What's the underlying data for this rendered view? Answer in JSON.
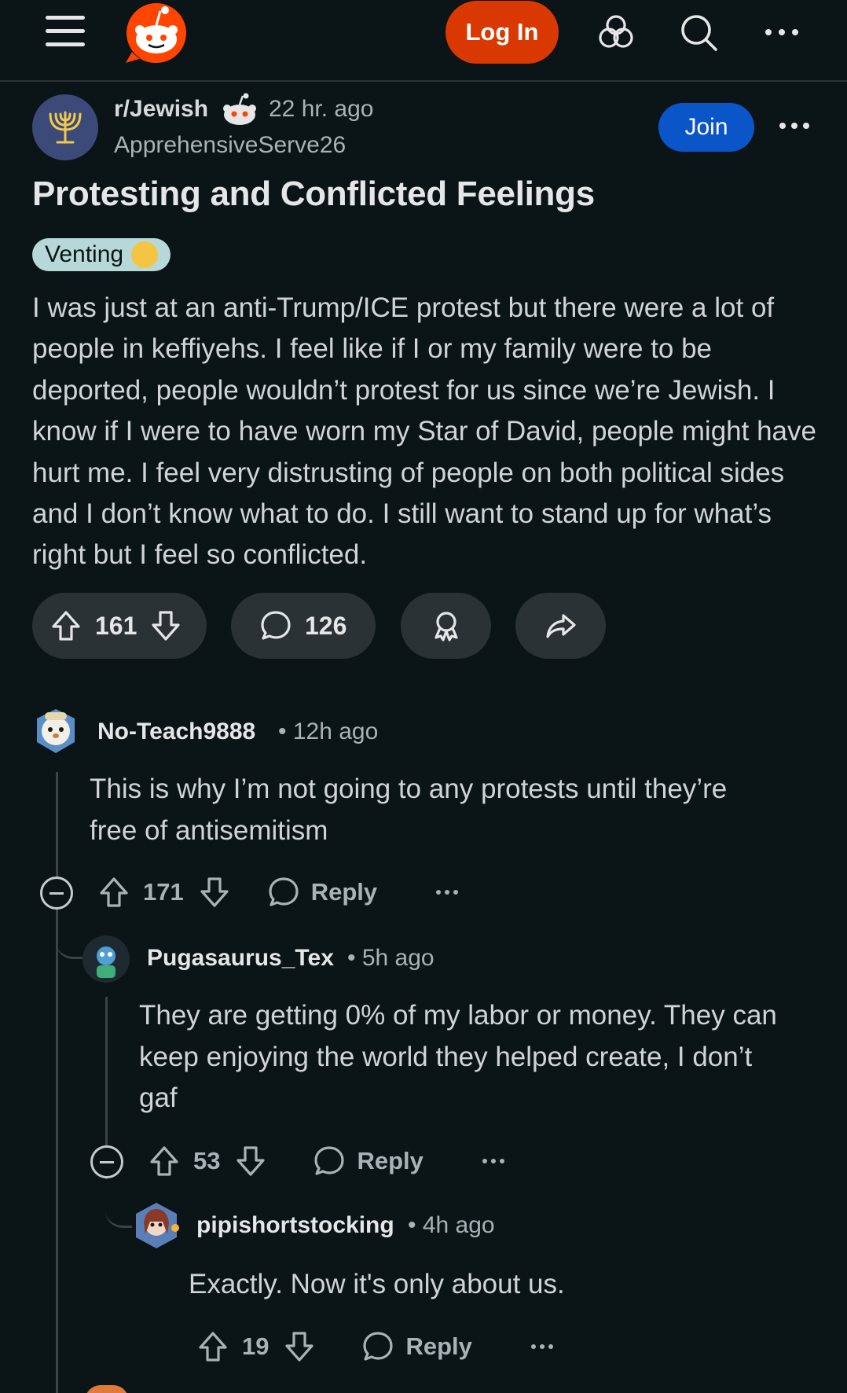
{
  "topbar": {
    "login_label": "Log In",
    "icons": [
      "menu-icon",
      "reddit-logo",
      "communities-icon",
      "search-icon",
      "more-icon"
    ],
    "accent": "#d93900"
  },
  "post": {
    "subreddit": "r/Jewish",
    "time": "22 hr. ago",
    "author": "ApprehensiveServe26",
    "join_label": "Join",
    "title": "Protesting and Conflicted Feelings",
    "flair": "Venting",
    "body": "I was just at an anti-Trump/ICE protest but there were a lot of people in keffiyehs. I feel like if I or my family were to be deported, people wouldn’t protest for us since we’re Jewish. I know if I were to have worn my Star of David, people might have hurt me. I feel very distrusting of people on both political sides and I don’t know what to do. I still want to stand up for what’s right but I feel so conflicted.",
    "votes": "161",
    "comments": "126"
  },
  "comments": [
    {
      "user": "No-Teach9888",
      "time": "12h ago",
      "body_line1": "This is why I’m not going to any protests until they’re",
      "body_line2": "free of antisemitism",
      "votes": "171",
      "reply_label": "Reply"
    },
    {
      "user": "Pugasaurus_Tex",
      "time": "5h ago",
      "body_line1": "They are getting 0% of my labor or money. They can",
      "body_line2": "keep enjoying the world they helped create, I don’t",
      "body_line3": "gaf",
      "votes": "53",
      "reply_label": "Reply"
    },
    {
      "user": "pipishortstocking",
      "time": "4h ago",
      "body_line1": "Exactly. Now it's only about us.",
      "votes": "19",
      "reply_label": "Reply"
    }
  ]
}
